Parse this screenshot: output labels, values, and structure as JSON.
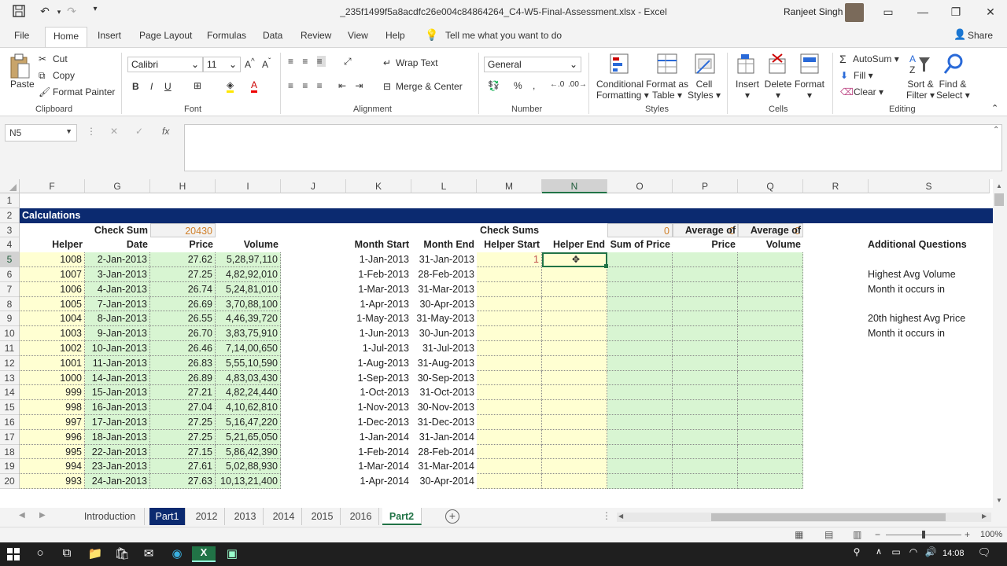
{
  "window": {
    "title": "_235f1499f5a8acdfc26e004c84864264_C4-W5-Final-Assessment.xlsx  -  Excel",
    "user": "Ranjeet Singh"
  },
  "tabs": [
    "File",
    "Home",
    "Insert",
    "Page Layout",
    "Formulas",
    "Data",
    "Review",
    "View",
    "Help"
  ],
  "tell_me": "Tell me what you want to do",
  "share": "Share",
  "ribbon": {
    "clipboard": {
      "paste": "Paste",
      "cut": "Cut",
      "copy": "Copy",
      "format_painter": "Format Painter",
      "group": "Clipboard"
    },
    "font": {
      "name": "Calibri",
      "size": "11",
      "bold": "B",
      "italic": "I",
      "underline": "U",
      "group": "Font"
    },
    "alignment": {
      "wrap": "Wrap Text",
      "merge": "Merge & Center",
      "group": "Alignment"
    },
    "number": {
      "format": "General",
      "percent": "%",
      "comma": ",",
      "group": "Number"
    },
    "styles": {
      "conditional": "Conditional",
      "conditional2": "Formatting",
      "format_as": "Format as",
      "format_as2": "Table",
      "cell": "Cell",
      "cell2": "Styles",
      "group": "Styles"
    },
    "cells": {
      "insert": "Insert",
      "delete": "Delete",
      "format": "Format",
      "group": "Cells"
    },
    "editing": {
      "autosum": "AutoSum",
      "fill": "Fill",
      "clear": "Clear",
      "sort": "Sort &",
      "sort2": "Filter",
      "find": "Find &",
      "find2": "Select",
      "group": "Editing"
    }
  },
  "name_box": "N5",
  "fx": "fx",
  "columns": [
    "F",
    "G",
    "H",
    "I",
    "J",
    "K",
    "L",
    "M",
    "N",
    "O",
    "P",
    "Q",
    "R",
    "S"
  ],
  "rows": [
    "1",
    "2",
    "3",
    "4",
    "5",
    "6",
    "7",
    "8",
    "9",
    "10",
    "11",
    "12",
    "13",
    "14",
    "15",
    "16",
    "17",
    "18",
    "19",
    "20"
  ],
  "sheet": {
    "calculations": "Calculations",
    "check_sum_label": "Check Sum",
    "check_sum_value": "20430",
    "check_sums_label": "Check Sums",
    "check_sums_values": [
      "0",
      "0",
      "0"
    ],
    "headers": {
      "helper": "Helper",
      "date": "Date",
      "price": "Price",
      "volume": "Volume",
      "month_start": "Month Start",
      "month_end": "Month End",
      "helper_start": "Helper Start",
      "helper_end": "Helper End",
      "sum_price": "Sum of Price",
      "avg_price_1": "Average of",
      "avg_price_2": "Price",
      "avg_vol_1": "Average of",
      "avg_vol_2": "Volume",
      "additional": "Additional Questions"
    },
    "questions": [
      "Highest Avg Volume",
      "Month it occurs in",
      "20th highest Avg Price",
      "Month it occurs in"
    ],
    "helper_start_first": "1",
    "data": [
      [
        "1008",
        "2-Jan-2013",
        "27.62",
        "5,28,97,110",
        "1-Jan-2013",
        "31-Jan-2013"
      ],
      [
        "1007",
        "3-Jan-2013",
        "27.25",
        "4,82,92,010",
        "1-Feb-2013",
        "28-Feb-2013"
      ],
      [
        "1006",
        "4-Jan-2013",
        "26.74",
        "5,24,81,010",
        "1-Mar-2013",
        "31-Mar-2013"
      ],
      [
        "1005",
        "7-Jan-2013",
        "26.69",
        "3,70,88,100",
        "1-Apr-2013",
        "30-Apr-2013"
      ],
      [
        "1004",
        "8-Jan-2013",
        "26.55",
        "4,46,39,720",
        "1-May-2013",
        "31-May-2013"
      ],
      [
        "1003",
        "9-Jan-2013",
        "26.70",
        "3,83,75,910",
        "1-Jun-2013",
        "30-Jun-2013"
      ],
      [
        "1002",
        "10-Jan-2013",
        "26.46",
        "7,14,00,650",
        "1-Jul-2013",
        "31-Jul-2013"
      ],
      [
        "1001",
        "11-Jan-2013",
        "26.83",
        "5,55,10,590",
        "1-Aug-2013",
        "31-Aug-2013"
      ],
      [
        "1000",
        "14-Jan-2013",
        "26.89",
        "4,83,03,430",
        "1-Sep-2013",
        "30-Sep-2013"
      ],
      [
        "999",
        "15-Jan-2013",
        "27.21",
        "4,82,24,440",
        "1-Oct-2013",
        "31-Oct-2013"
      ],
      [
        "998",
        "16-Jan-2013",
        "27.04",
        "4,10,62,810",
        "1-Nov-2013",
        "30-Nov-2013"
      ],
      [
        "997",
        "17-Jan-2013",
        "27.25",
        "5,16,47,220",
        "1-Dec-2013",
        "31-Dec-2013"
      ],
      [
        "996",
        "18-Jan-2013",
        "27.25",
        "5,21,65,050",
        "1-Jan-2014",
        "31-Jan-2014"
      ],
      [
        "995",
        "22-Jan-2013",
        "27.15",
        "5,86,42,390",
        "1-Feb-2014",
        "28-Feb-2014"
      ],
      [
        "994",
        "23-Jan-2013",
        "27.61",
        "5,02,88,930",
        "1-Mar-2014",
        "31-Mar-2014"
      ],
      [
        "993",
        "24-Jan-2013",
        "27.63",
        "10,13,21,400",
        "1-Apr-2014",
        "30-Apr-2014"
      ]
    ]
  },
  "sheet_tabs": [
    "Introduction",
    "Part1",
    "2012",
    "2013",
    "2014",
    "2015",
    "2016",
    "Part2"
  ],
  "active_sheet": "Part2",
  "zoom": "100%",
  "clock": "14:08",
  "colors": {
    "excel_green": "#217346",
    "title_blue": "#0b2a70",
    "helper_yellow": "#ffffd2",
    "data_green": "#d8f5d2",
    "orange": "#d0802a"
  }
}
